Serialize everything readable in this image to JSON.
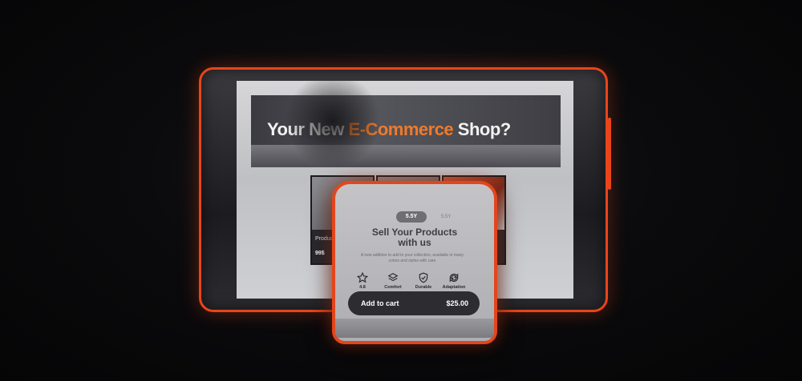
{
  "tablet": {
    "hero": {
      "title_prefix": "Your New ",
      "title_accent": "E-Commerce",
      "title_suffix": " Shop?"
    },
    "products": [
      {
        "name": "Product 1",
        "price": "99$"
      },
      {
        "name": "",
        "price": ""
      },
      {
        "name": "",
        "price": ""
      }
    ]
  },
  "phone": {
    "pill_label": "5.5Y",
    "pill_left": "",
    "pill_right": "5.5Y",
    "title_line1": "Sell Your Products",
    "title_line2": "with us",
    "description": "A new addition to add to your collection, available in many colors and styles with care",
    "features": [
      {
        "icon": "star-icon",
        "label": "4.8"
      },
      {
        "icon": "layers-icon",
        "label": "Comfort"
      },
      {
        "icon": "shield-icon",
        "label": "Durable"
      },
      {
        "icon": "refresh-icon",
        "label": "Adaptation"
      }
    ],
    "cart": {
      "label": "Add to cart",
      "price": "$25.00"
    }
  },
  "colors": {
    "accent": "#e8451a",
    "hero_accent": "#f07a2a",
    "background": "#0b0b0d"
  }
}
